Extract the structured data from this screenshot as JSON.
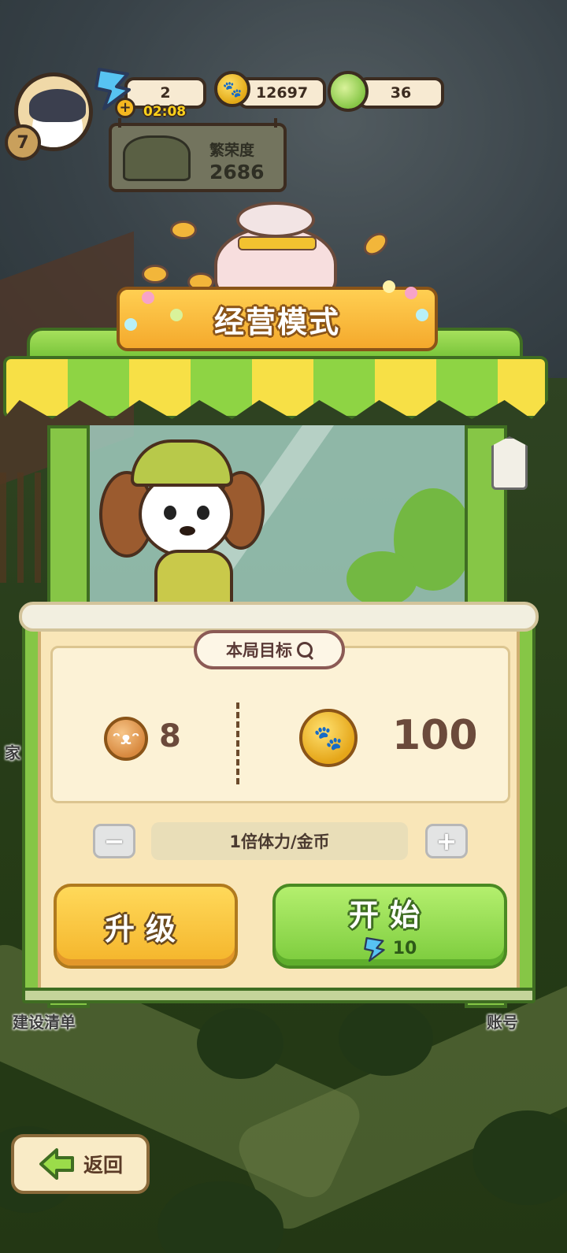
{
  "hud": {
    "level": "7",
    "energy": "2",
    "energy_timer": "02:08",
    "coins": "12697",
    "vegetables": "36",
    "prosperity_label": "繁荣度",
    "prosperity_value": "2686"
  },
  "side_labels": {
    "left_top": "家",
    "build_list": "建设清单",
    "account": "账号"
  },
  "shop": {
    "title": "经营模式"
  },
  "goal": {
    "header": "本局目标",
    "cat_token_count": "8",
    "coin_target": "100"
  },
  "multiplier": {
    "minus": "−",
    "value": "1倍体力/金币",
    "plus": "+"
  },
  "actions": {
    "upgrade_label": "升级",
    "start_label": "开始",
    "start_cost": "10"
  },
  "nav": {
    "back_label": "返回"
  },
  "colors": {
    "awning_yellow": "#f7e046",
    "awning_green": "#8ed444",
    "button_yellow": "#f4b42a",
    "button_green": "#7bcb3c",
    "panel_cream": "#f9e6b8"
  },
  "icons": {
    "energy": "lightning-icon",
    "coin": "paw-coin-icon",
    "vegetable": "cabbage-icon",
    "goal_search": "magnifier-icon",
    "back": "arrow-left-icon"
  }
}
